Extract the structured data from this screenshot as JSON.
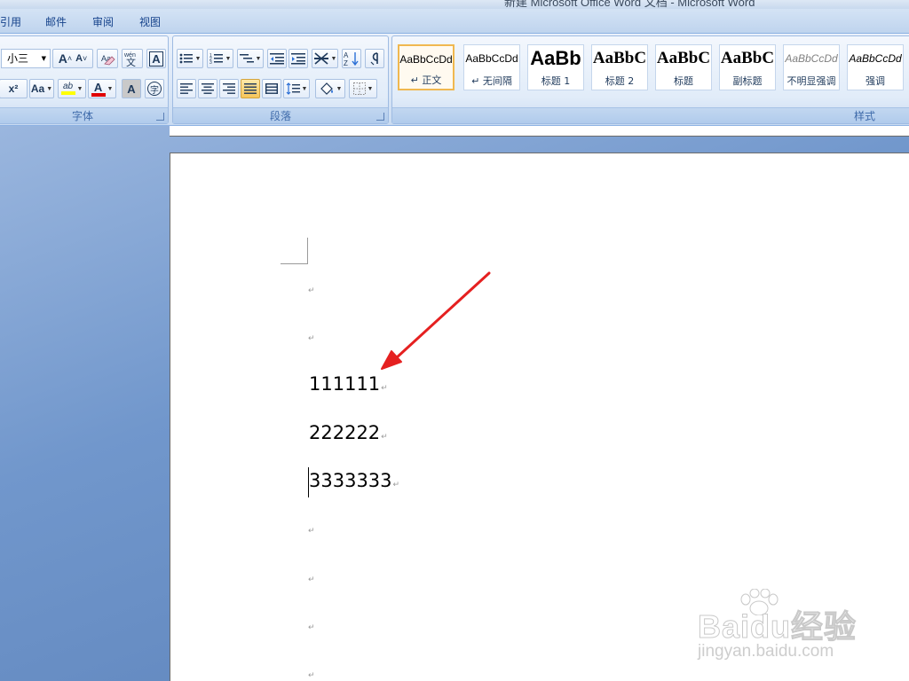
{
  "window": {
    "title": "新建 Microsoft Office Word 文档 - Microsoft Word"
  },
  "tabs": [
    {
      "label": "引用"
    },
    {
      "label": "邮件"
    },
    {
      "label": "审阅"
    },
    {
      "label": "视图"
    }
  ],
  "font_group": {
    "font_size": "小三",
    "label": "字体",
    "grow_font": "A",
    "shrink_font": "A",
    "superscript": "x²",
    "change_case": "Aa",
    "highlight": "ab",
    "font_color": "A",
    "char_shading": "A",
    "enclose": "字",
    "phonetic": "wén",
    "char_border": "A"
  },
  "paragraph_group": {
    "label": "段落"
  },
  "styles_group": {
    "label": "样式",
    "items": [
      {
        "sample": "AaBbCcDd",
        "name": "↵ 正文",
        "selected": true
      },
      {
        "sample": "AaBbCcDd",
        "name": "↵ 无间隔"
      },
      {
        "sample": "AaBb",
        "name": "标题 1"
      },
      {
        "sample": "AaBbC",
        "name": "标题 2"
      },
      {
        "sample": "AaBbC",
        "name": "标题"
      },
      {
        "sample": "AaBbC",
        "name": "副标题"
      },
      {
        "sample": "AaBbCcDd",
        "name": "不明显强调"
      },
      {
        "sample": "AaBbCcDd",
        "name": "强调"
      }
    ]
  },
  "document": {
    "lines": [
      {
        "text": ""
      },
      {
        "text": ""
      },
      {
        "text": "111111"
      },
      {
        "text": "222222"
      },
      {
        "text": "3333333"
      },
      {
        "text": ""
      },
      {
        "text": ""
      },
      {
        "text": ""
      },
      {
        "text": ""
      }
    ],
    "paragraph_mark": "↵"
  },
  "annotation": {
    "color": "#e52020"
  },
  "watermark": {
    "brand": "Baidu经验",
    "url": "jingyan.baidu.com"
  }
}
